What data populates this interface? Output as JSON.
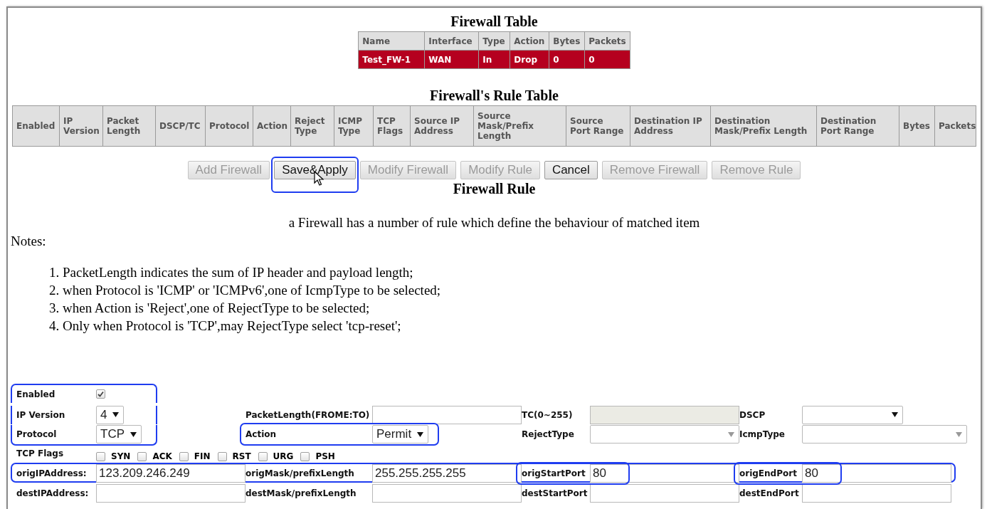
{
  "firewall_table": {
    "title": "Firewall Table",
    "columns": [
      "Name",
      "Interface",
      "Type",
      "Action",
      "Bytes",
      "Packets"
    ],
    "rows": [
      {
        "selected": true,
        "cells": [
          "Test_FW-1",
          "WAN",
          "In",
          "Drop",
          "0",
          "0"
        ]
      }
    ]
  },
  "rule_table": {
    "title": "Firewall's Rule Table",
    "columns": [
      "Enabled",
      "IP Version",
      "Packet Length",
      "DSCP/TC",
      "Protocol",
      "Action",
      "Reject Type",
      "ICMP Type",
      "TCP Flags",
      "Source IP Address",
      "Source Mask/Prefix Length",
      "Source Port Range",
      "Destination IP Address",
      "Destination Mask/Prefix Length",
      "Destination Port Range",
      "Bytes",
      "Packets"
    ]
  },
  "buttons": [
    {
      "label": "Add Firewall",
      "disabled": true,
      "highlighted": false
    },
    {
      "label": "Save&Apply",
      "disabled": false,
      "highlighted": true
    },
    {
      "label": "Modify Firewall",
      "disabled": true,
      "highlighted": false
    },
    {
      "label": "Modify Rule",
      "disabled": true,
      "highlighted": false
    },
    {
      "label": "Cancel",
      "disabled": false,
      "highlighted": false
    },
    {
      "label": "Remove Firewall",
      "disabled": true,
      "highlighted": false
    },
    {
      "label": "Remove Rule",
      "disabled": true,
      "highlighted": false
    }
  ],
  "rule_section": {
    "title": "Firewall Rule",
    "description": "a Firewall has a number of rule which define the behaviour of matched item",
    "notes_label": "Notes:",
    "notes": [
      "1. PacketLength indicates the sum of IP header and payload length;",
      "2. when Protocol is 'ICMP' or 'ICMPv6',one of IcmpType to be selected;",
      "3. when Action is 'Reject',one of RejectType to be selected;",
      "4. Only when Protocol is 'TCP',may RejectType select 'tcp-reset';"
    ]
  },
  "form": {
    "rows": [
      {
        "highlighted": false,
        "fields": [
          {
            "label": "Enabled",
            "kind": "checkbox",
            "checked": true,
            "highlighted": true
          }
        ]
      },
      {
        "highlighted": false,
        "fields": [
          {
            "label": "IP Version",
            "kind": "select",
            "value": "4",
            "disabled": false,
            "highlighted": true
          },
          {
            "label": "PacketLength(FROME:TO)",
            "kind": "input",
            "disabled": false,
            "highlighted": false
          },
          {
            "label": "TC(0~255)",
            "kind": "input",
            "disabled": true,
            "highlighted": false
          },
          {
            "label": "DSCP",
            "kind": "select",
            "disabled": false,
            "highlighted": false
          }
        ]
      },
      {
        "highlighted": false,
        "fields": [
          {
            "label": "Protocol",
            "kind": "select",
            "value": "TCP",
            "disabled": false,
            "highlighted": true
          },
          {
            "label": "Action",
            "kind": "select",
            "value": "Permit",
            "disabled": false,
            "highlighted": true
          },
          {
            "label": "RejectType",
            "kind": "select",
            "disabled": true,
            "highlighted": false
          },
          {
            "label": "IcmpType",
            "kind": "select",
            "disabled": true,
            "highlighted": false
          }
        ]
      },
      {
        "highlighted": false,
        "fields": [
          {
            "label": "TCP Flags",
            "kind": "flags",
            "highlighted": false,
            "flags": [
              {
                "label": "SYN",
                "checked": false
              },
              {
                "label": "ACK",
                "checked": false
              },
              {
                "label": "FIN",
                "checked": false
              },
              {
                "label": "RST",
                "checked": false
              },
              {
                "label": "URG",
                "checked": false
              },
              {
                "label": "PSH",
                "checked": false
              }
            ]
          }
        ]
      },
      {
        "highlighted": true,
        "fields": [
          {
            "label": "origIPAddress:",
            "kind": "input",
            "value": "123.209.246.249",
            "disabled": false,
            "highlighted": false
          },
          {
            "label": "origMask/prefixLength",
            "kind": "input",
            "value": "255.255.255.255",
            "disabled": false,
            "highlighted": false
          },
          {
            "label": "origStartPort",
            "kind": "input",
            "value": "80",
            "disabled": false,
            "highlighted": true
          },
          {
            "label": "origEndPort",
            "kind": "input",
            "value": "80",
            "disabled": false,
            "highlighted": true
          }
        ]
      },
      {
        "highlighted": false,
        "fields": [
          {
            "label": "destIPAddress:",
            "kind": "input",
            "disabled": false,
            "highlighted": false
          },
          {
            "label": "destMask/prefixLength",
            "kind": "input",
            "disabled": false,
            "highlighted": false
          },
          {
            "label": "destStartPort",
            "kind": "input",
            "disabled": false,
            "highlighted": false
          },
          {
            "label": "destEndPort",
            "kind": "input",
            "disabled": false,
            "highlighted": false
          }
        ]
      }
    ]
  }
}
